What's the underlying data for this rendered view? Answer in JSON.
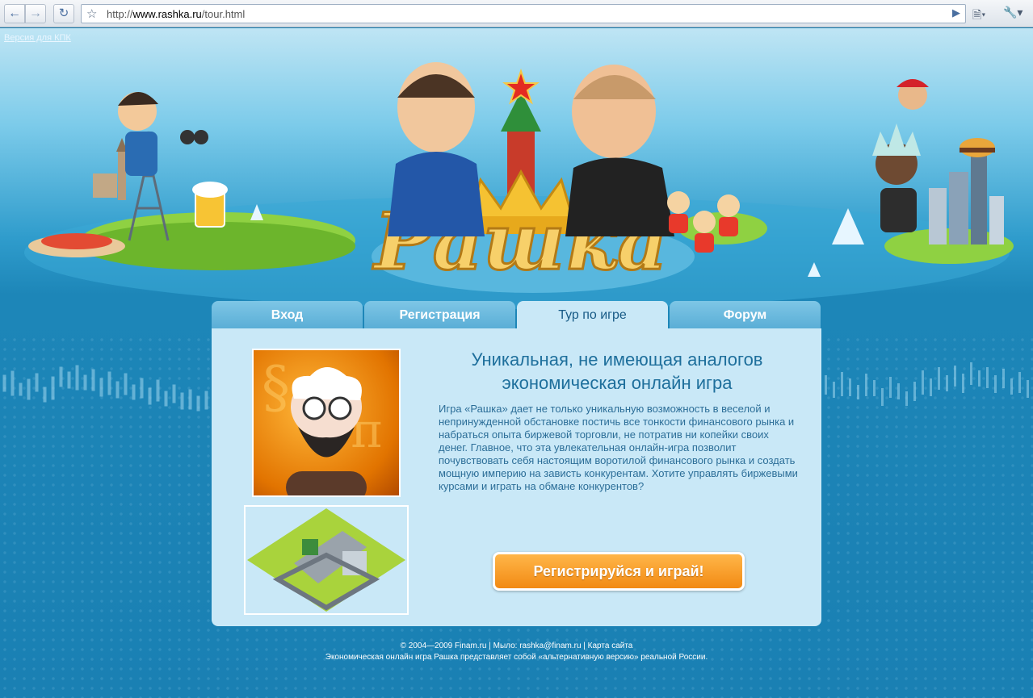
{
  "browser": {
    "url_prefix": "http://",
    "url_domain": "www.rashka.ru",
    "url_path": "/tour.html"
  },
  "page": {
    "kpk_link": "Версия для КПК",
    "logo_text": "Рашка"
  },
  "tabs": [
    {
      "label": "Вход"
    },
    {
      "label": "Регистрация"
    },
    {
      "label": "Тур по игре"
    },
    {
      "label": "Форум"
    }
  ],
  "content": {
    "headline_line1": "Уникальная, не имеющая аналогов",
    "headline_line2": "экономическая онлайн игра",
    "description": "Игра «Рашка» дает не только уникальную возможность в веселой и непринужденной обстановке постичь все тонкости финансового рынка и набраться опыта биржевой торговли, не потратив ни копейки своих денег. Главное, что эта увлекательная онлайн-игра позволит почувствовать себя настоящим воротилой финансового рынка и создать мощную империю на зависть конкурентам. Хотите управлять биржевыми курсами и играть на обмане конкурентов?",
    "cta_label": "Регистрируйся и играй!"
  },
  "footer": {
    "line1": "© 2004—2009 Finam.ru | Мыло: rashka@finam.ru | Карта сайта",
    "line2": "Экономическая онлайн игра Рашка представляет собой «альтернативную версию» реальной России."
  },
  "colors": {
    "tab_active_bg": "#c9e8f7",
    "tab_bg": "#5aaed6",
    "cta": "#f28a13",
    "text_blue": "#1e6f9c"
  }
}
